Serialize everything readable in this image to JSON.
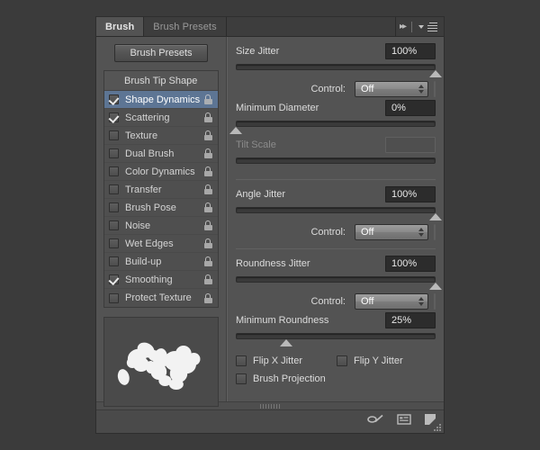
{
  "tabs": [
    {
      "label": "Brush",
      "active": true
    },
    {
      "label": "Brush Presets",
      "active": false
    }
  ],
  "titlebar": {
    "collapse_icon": "double-chevron-right-icon",
    "menu_icon": "panel-menu-icon"
  },
  "left": {
    "presets_button": "Brush Presets",
    "list_header": "Brush Tip Shape",
    "items": [
      {
        "label": "Shape Dynamics",
        "checked": true,
        "selected": true,
        "locked": false
      },
      {
        "label": "Scattering",
        "checked": true,
        "selected": false,
        "locked": false
      },
      {
        "label": "Texture",
        "checked": false,
        "selected": false,
        "locked": false
      },
      {
        "label": "Dual Brush",
        "checked": false,
        "selected": false,
        "locked": false
      },
      {
        "label": "Color Dynamics",
        "checked": false,
        "selected": false,
        "locked": false
      },
      {
        "label": "Transfer",
        "checked": false,
        "selected": false,
        "locked": false
      },
      {
        "label": "Brush Pose",
        "checked": false,
        "selected": false,
        "locked": false
      },
      {
        "label": "Noise",
        "checked": false,
        "selected": false,
        "locked": false
      },
      {
        "label": "Wet Edges",
        "checked": false,
        "selected": false,
        "locked": false
      },
      {
        "label": "Build-up",
        "checked": false,
        "selected": false,
        "locked": false
      },
      {
        "label": "Smoothing",
        "checked": true,
        "selected": false,
        "locked": false
      },
      {
        "label": "Protect Texture",
        "checked": false,
        "selected": false,
        "locked": false
      }
    ],
    "lock_icon": "padlock-open-icon",
    "preview_name": "brush-stroke-preview"
  },
  "right": {
    "size_jitter": {
      "label": "Size Jitter",
      "value": "100%",
      "slider_percent": 100,
      "control_label": "Control:",
      "control_value": "Off",
      "control_extra": ""
    },
    "minimum_diameter": {
      "label": "Minimum Diameter",
      "value": "0%",
      "slider_percent": 0
    },
    "tilt_scale": {
      "label": "Tilt Scale",
      "value": "",
      "disabled": true,
      "slider_percent": null
    },
    "angle_jitter": {
      "label": "Angle Jitter",
      "value": "100%",
      "slider_percent": 100,
      "control_label": "Control:",
      "control_value": "Off",
      "control_extra": ""
    },
    "roundness_jitter": {
      "label": "Roundness Jitter",
      "value": "100%",
      "slider_percent": 100,
      "control_label": "Control:",
      "control_value": "Off",
      "control_extra": ""
    },
    "minimum_roundness": {
      "label": "Minimum Roundness",
      "value": "25%",
      "slider_percent": 25
    },
    "flip_x": {
      "label": "Flip X Jitter",
      "checked": false
    },
    "flip_y": {
      "label": "Flip Y Jitter",
      "checked": false
    },
    "brush_projection": {
      "label": "Brush Projection",
      "checked": false
    }
  },
  "footer": {
    "icons": [
      {
        "name": "toggle-airbrush-icon"
      },
      {
        "name": "brush-preset-picker-icon"
      },
      {
        "name": "new-brush-icon"
      }
    ],
    "resize_grip": "resize-grip-icon"
  },
  "colors": {
    "panel_bg": "#535353",
    "tabbar_bg": "#3d3d3d",
    "selection": "#5d7594",
    "field_bg": "#2c2c2c",
    "text": "#dcdcdc",
    "app_bg": "#3b3b3b"
  }
}
